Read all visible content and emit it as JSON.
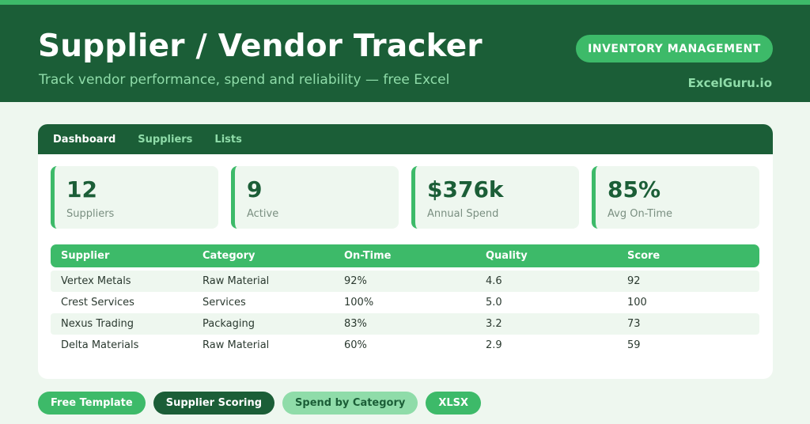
{
  "header": {
    "title": "Supplier / Vendor Tracker",
    "subtitle": "Track vendor performance, spend and reliability — free Excel",
    "badge": "INVENTORY MANAGEMENT",
    "brand": "ExcelGuru.io"
  },
  "tabs": [
    {
      "label": "Dashboard",
      "active": true
    },
    {
      "label": "Suppliers",
      "active": false
    },
    {
      "label": "Lists",
      "active": false
    }
  ],
  "kpis": [
    {
      "value": "12",
      "label": "Suppliers"
    },
    {
      "value": "9",
      "label": "Active"
    },
    {
      "value": "$376k",
      "label": "Annual Spend"
    },
    {
      "value": "85%",
      "label": "Avg On-Time"
    }
  ],
  "table": {
    "columns": [
      "Supplier",
      "Category",
      "On-Time",
      "Quality",
      "Score"
    ],
    "rows": [
      [
        "Vertex Metals",
        "Raw Material",
        "92%",
        "4.6",
        "92"
      ],
      [
        "Crest Services",
        "Services",
        "100%",
        "5.0",
        "100"
      ],
      [
        "Nexus Trading",
        "Packaging",
        "83%",
        "3.2",
        "73"
      ],
      [
        "Delta Materials",
        "Raw Material",
        "60%",
        "2.9",
        "59"
      ]
    ]
  },
  "tags": [
    "Free Template",
    "Supplier Scoring",
    "Spend by Category",
    "XLSX"
  ],
  "colors": {
    "dark_green": "#1b5e37",
    "accent_green": "#3dba69",
    "light_green": "#8fdca9",
    "background": "#eef7ef"
  }
}
